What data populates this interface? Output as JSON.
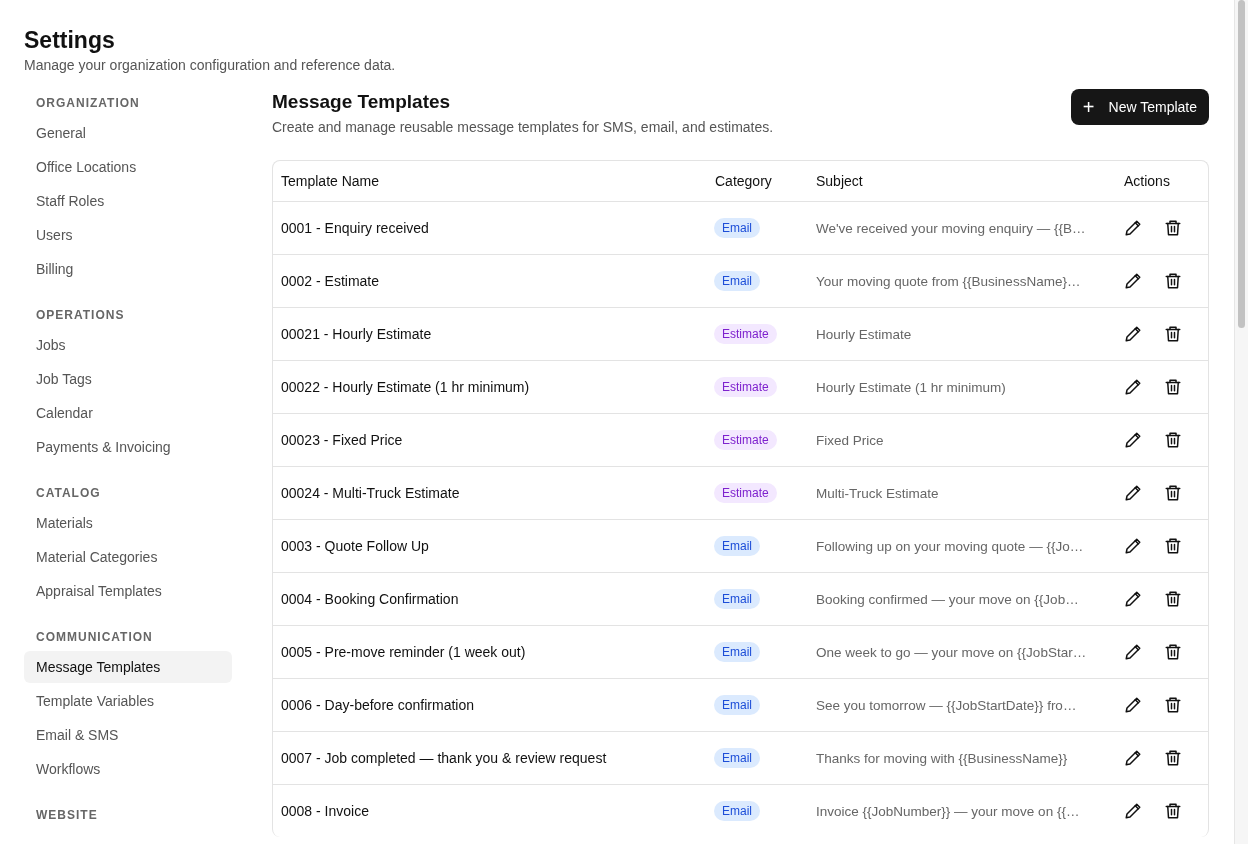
{
  "header": {
    "title": "Settings",
    "subtitle": "Manage your organization configuration and reference data."
  },
  "sidebar": {
    "sections": [
      {
        "heading": "ORGANIZATION",
        "items": [
          {
            "label": "General",
            "selected": false
          },
          {
            "label": "Office Locations",
            "selected": false
          },
          {
            "label": "Staff Roles",
            "selected": false
          },
          {
            "label": "Users",
            "selected": false
          },
          {
            "label": "Billing",
            "selected": false
          }
        ]
      },
      {
        "heading": "OPERATIONS",
        "items": [
          {
            "label": "Jobs",
            "selected": false
          },
          {
            "label": "Job Tags",
            "selected": false
          },
          {
            "label": "Calendar",
            "selected": false
          },
          {
            "label": "Payments & Invoicing",
            "selected": false
          }
        ]
      },
      {
        "heading": "CATALOG",
        "items": [
          {
            "label": "Materials",
            "selected": false
          },
          {
            "label": "Material Categories",
            "selected": false
          },
          {
            "label": "Appraisal Templates",
            "selected": false
          }
        ]
      },
      {
        "heading": "COMMUNICATION",
        "items": [
          {
            "label": "Message Templates",
            "selected": true
          },
          {
            "label": "Template Variables",
            "selected": false
          },
          {
            "label": "Email & SMS",
            "selected": false
          },
          {
            "label": "Workflows",
            "selected": false
          }
        ]
      },
      {
        "heading": "WEBSITE"
      }
    ]
  },
  "page": {
    "title": "Message Templates",
    "description": "Create and manage reusable message templates for SMS, email, and estimates.",
    "new_button": {
      "icon": "+",
      "label": "New Template"
    }
  },
  "table": {
    "columns": [
      "Template Name",
      "Category",
      "Subject",
      "Actions"
    ],
    "rows": [
      {
        "name": "0001 - Enquiry received",
        "category": {
          "label": "Email",
          "kind": "email"
        },
        "subject": "We've received your moving enquiry — {{B…"
      },
      {
        "name": "0002 - Estimate",
        "category": {
          "label": "Email",
          "kind": "email"
        },
        "subject": "Your moving quote from {{BusinessName}…"
      },
      {
        "name": "00021 - Hourly Estimate",
        "category": {
          "label": "Estimate",
          "kind": "estimate"
        },
        "subject": "Hourly Estimate"
      },
      {
        "name": "00022 - Hourly Estimate (1 hr minimum)",
        "category": {
          "label": "Estimate",
          "kind": "estimate"
        },
        "subject": "Hourly Estimate (1 hr minimum)"
      },
      {
        "name": "00023 - Fixed Price",
        "category": {
          "label": "Estimate",
          "kind": "estimate"
        },
        "subject": "Fixed Price"
      },
      {
        "name": "00024 - Multi-Truck Estimate",
        "category": {
          "label": "Estimate",
          "kind": "estimate"
        },
        "subject": "Multi-Truck Estimate"
      },
      {
        "name": "0003 - Quote Follow Up",
        "category": {
          "label": "Email",
          "kind": "email"
        },
        "subject": "Following up on your moving quote — {{Jo…"
      },
      {
        "name": "0004 - Booking Confirmation",
        "category": {
          "label": "Email",
          "kind": "email"
        },
        "subject": "Booking confirmed — your move on {{Job…"
      },
      {
        "name": "0005 - Pre-move reminder (1 week out)",
        "category": {
          "label": "Email",
          "kind": "email"
        },
        "subject": "One week to go — your move on {{JobStar…"
      },
      {
        "name": "0006 - Day-before confirmation",
        "category": {
          "label": "Email",
          "kind": "email"
        },
        "subject": "See you tomorrow — {{JobStartDate}} fro…"
      },
      {
        "name": "0007 - Job completed — thank you & review request",
        "category": {
          "label": "Email",
          "kind": "email"
        },
        "subject": "Thanks for moving with {{BusinessName}}"
      },
      {
        "name": "0008 - Invoice",
        "category": {
          "label": "Email",
          "kind": "email"
        },
        "subject": "Invoice {{JobNumber}} — your move on {{…"
      }
    ]
  }
}
